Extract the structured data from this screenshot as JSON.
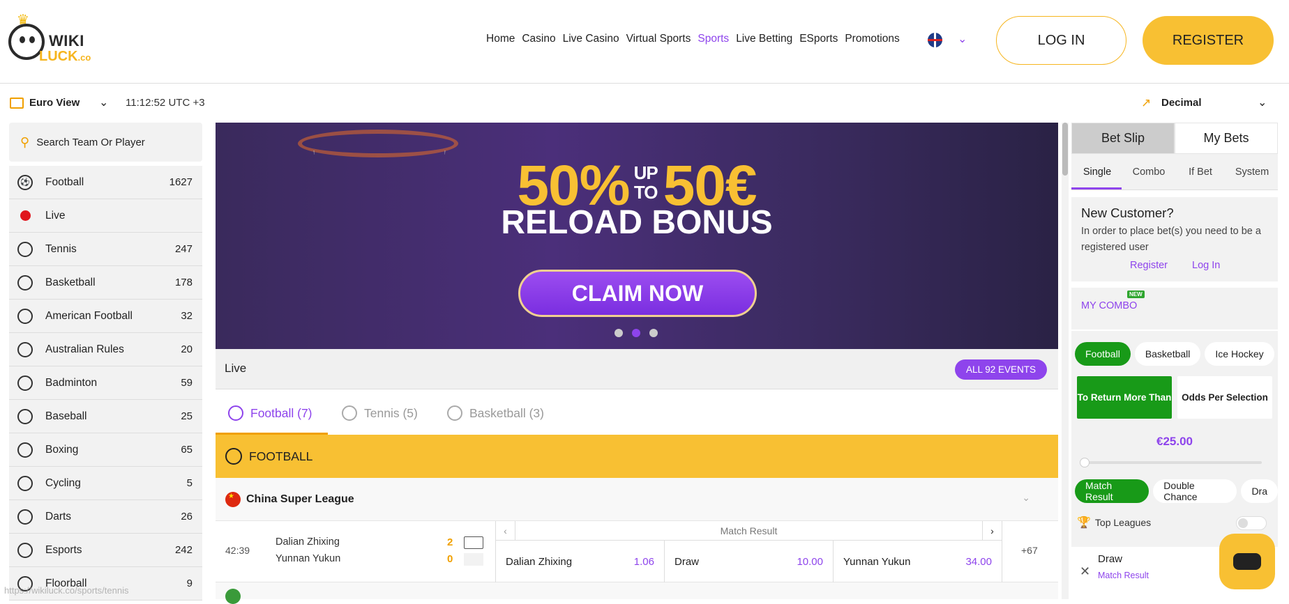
{
  "logo": {
    "line1": "WIKI",
    "line2": "LUCK",
    "suffix": ".co"
  },
  "nav": [
    "Home",
    "Casino",
    "Live Casino",
    "Virtual Sports",
    "Sports",
    "Live Betting",
    "ESports",
    "Promotions"
  ],
  "nav_active": "Sports",
  "header": {
    "login": "LOG IN",
    "register": "REGISTER"
  },
  "subbar": {
    "view": "Euro View",
    "clock": "11:12:52 UTC +3",
    "odds_format": "Decimal"
  },
  "search": {
    "placeholder": "Search Team Or Player"
  },
  "sports": [
    {
      "name": "Football",
      "count": "1627",
      "icon": "football-icon"
    },
    {
      "name": "Live",
      "count": "",
      "icon": "live-dot-icon"
    },
    {
      "name": "Tennis",
      "count": "247",
      "icon": "tennis-icon"
    },
    {
      "name": "Basketball",
      "count": "178",
      "icon": "basketball-icon"
    },
    {
      "name": "American Football",
      "count": "32",
      "icon": "american-football-icon"
    },
    {
      "name": "Australian Rules",
      "count": "20",
      "icon": "australian-rules-icon"
    },
    {
      "name": "Badminton",
      "count": "59",
      "icon": "badminton-icon"
    },
    {
      "name": "Baseball",
      "count": "25",
      "icon": "baseball-icon"
    },
    {
      "name": "Boxing",
      "count": "65",
      "icon": "boxing-icon"
    },
    {
      "name": "Cycling",
      "count": "5",
      "icon": "cycling-icon"
    },
    {
      "name": "Darts",
      "count": "26",
      "icon": "darts-icon"
    },
    {
      "name": "Esports",
      "count": "242",
      "icon": "esports-icon"
    },
    {
      "name": "Floorball",
      "count": "9",
      "icon": "floorball-icon"
    }
  ],
  "banner": {
    "pct": "50%",
    "up": "UP",
    "to": "TO",
    "amount": "50€",
    "bonus": "RELOAD BONUS",
    "cta": "CLAIM NOW",
    "active_slide": 2
  },
  "live": {
    "title": "Live",
    "all_events": "ALL 92 EVENTS"
  },
  "tabs": [
    "Football (7)",
    "Tennis (5)",
    "Basketball (3)"
  ],
  "section": {
    "title": "FOOTBALL"
  },
  "league": {
    "name": "China Super League"
  },
  "match": {
    "time": "42:39",
    "team1": "Dalian Zhixing",
    "score1": "2",
    "team2": "Yunnan Yukun",
    "score2": "0",
    "market": "Match Result",
    "odds": [
      {
        "label": "Dalian Zhixing",
        "value": "1.06"
      },
      {
        "label": "Draw",
        "value": "10.00"
      },
      {
        "label": "Yunnan Yukun",
        "value": "34.00"
      }
    ],
    "more": "+67"
  },
  "betslip": {
    "tabs": [
      "Bet Slip",
      "My Bets"
    ],
    "subtabs": [
      "Single",
      "Combo",
      "If Bet",
      "System"
    ],
    "new_customer_title": "New Customer?",
    "new_customer_text": "In order to place bet(s) you need to be a registered user",
    "register": "Register",
    "login": "Log In"
  },
  "combo": {
    "title": "MY COMBO",
    "badge": "NEW",
    "sports": [
      "Football",
      "Basketball",
      "Ice Hockey"
    ],
    "return_label": "To Return More Than",
    "per_selection": "Odds Per Selection",
    "amount": "€25.00",
    "markets": [
      "Match Result",
      "Double Chance",
      "Dra"
    ],
    "top_leagues": "Top Leagues",
    "selection": "Draw",
    "selection_market": "Match Result"
  },
  "status_url": "https://wikiluck.co/sports/tennis",
  "colors": {
    "accent": "#8e44ec",
    "brand_yellow": "#f8c033",
    "green": "#189a18"
  }
}
